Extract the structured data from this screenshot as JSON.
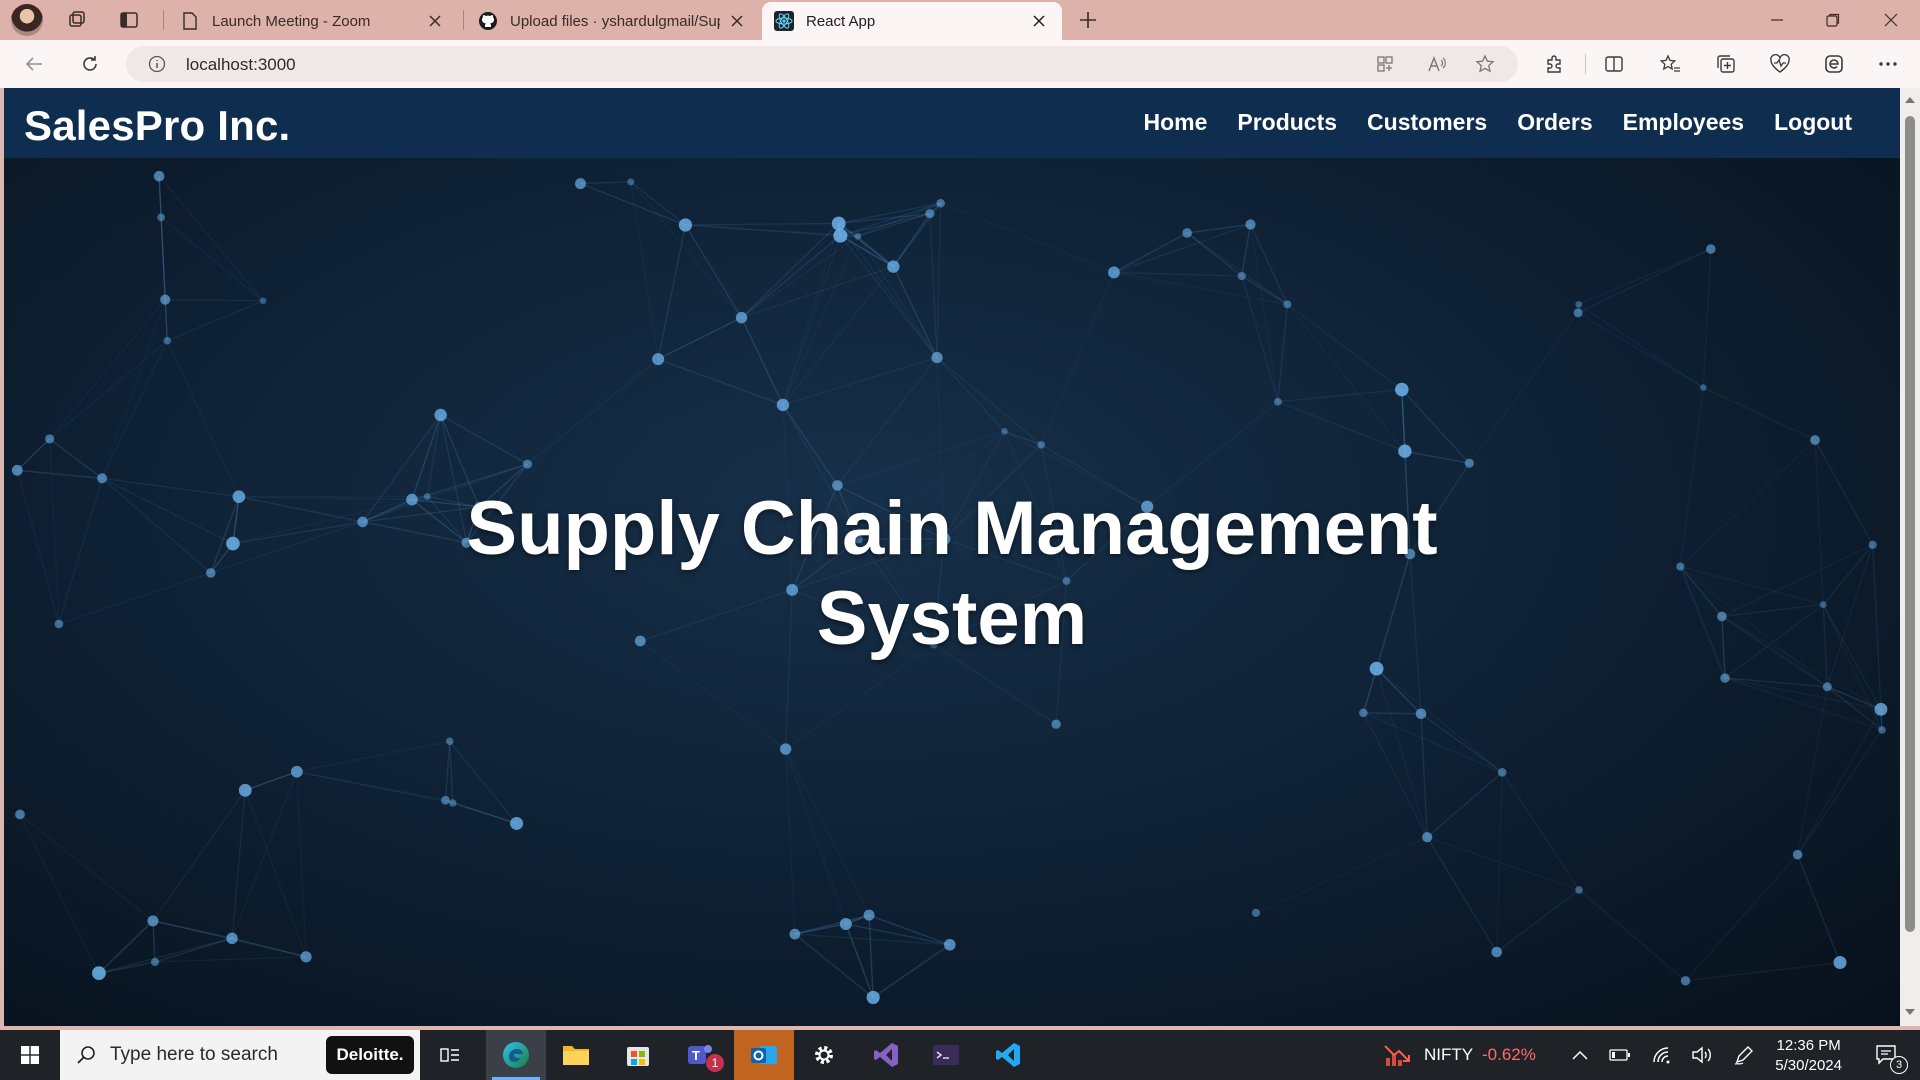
{
  "browser": {
    "tabs": [
      {
        "title": "Launch Meeting - Zoom",
        "icon": "document-icon",
        "active": false
      },
      {
        "title": "Upload files · yshardulgmail/Supp",
        "icon": "github-icon",
        "active": false
      },
      {
        "title": "React App",
        "icon": "react-icon",
        "active": true
      }
    ],
    "url": "localhost:3000"
  },
  "app": {
    "brand": "SalesPro Inc.",
    "nav": [
      "Home",
      "Products",
      "Customers",
      "Orders",
      "Employees",
      "Logout"
    ],
    "hero_title_line1": "Supply Chain Management",
    "hero_title_line2": "System"
  },
  "taskbar": {
    "search_placeholder": "Type here to search",
    "deloitte": "Deloitte.",
    "teams_badge": "1",
    "ticker_name": "NIFTY",
    "ticker_change": "-0.62%",
    "time": "12:36 PM",
    "date": "5/30/2024",
    "notifications": "3"
  },
  "colors": {
    "navbar": "#0e2d4f",
    "ticker_negative": "#ff6b6b",
    "tab_strip": "#dcb2ab"
  }
}
